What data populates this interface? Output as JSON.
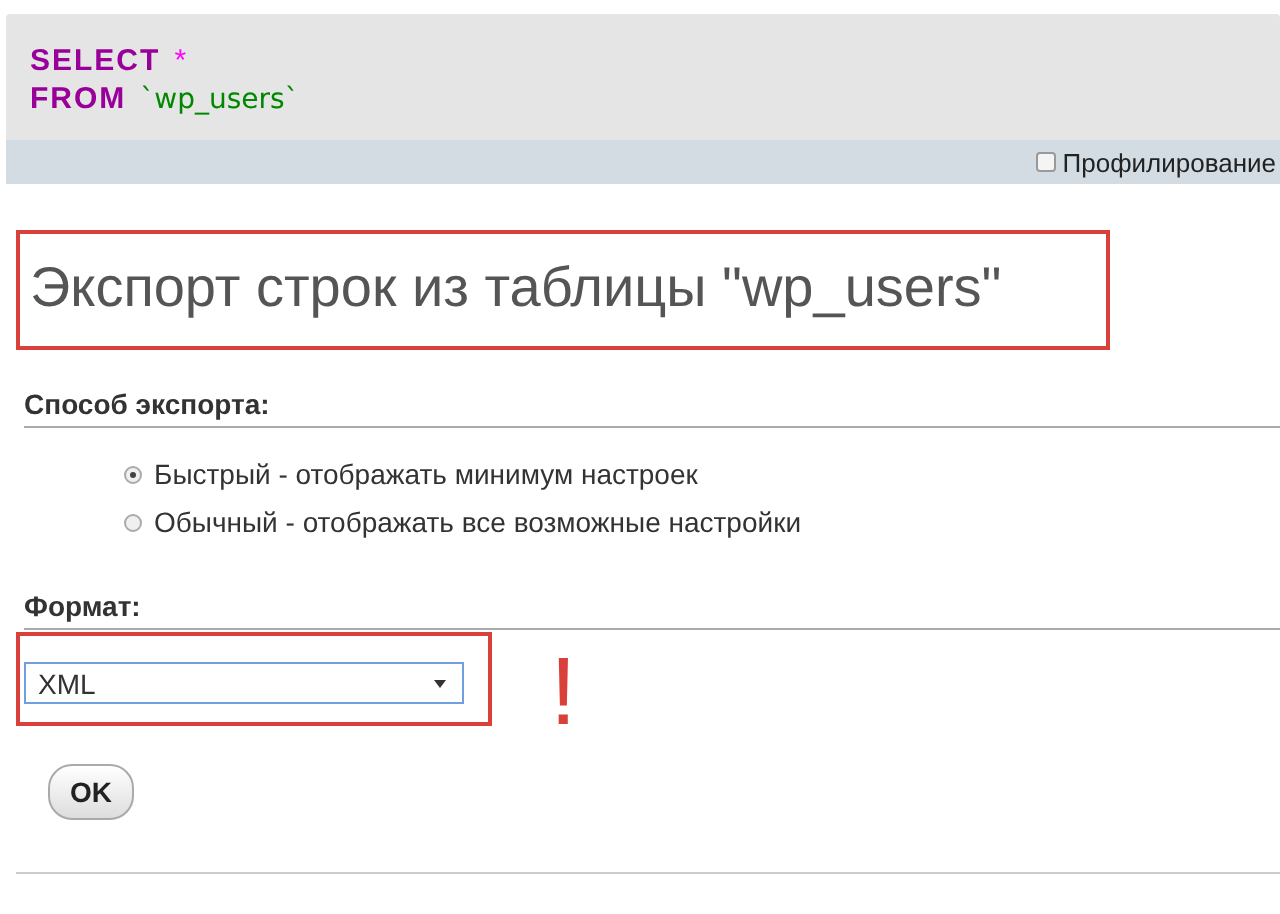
{
  "sql_query": {
    "lines": [
      [
        {
          "kind": "keyword",
          "text": "SELECT"
        },
        {
          "kind": "operator",
          "text": "*"
        }
      ],
      [
        {
          "kind": "keyword",
          "text": "FROM"
        },
        {
          "kind": "identifier",
          "text": "`wp_users`"
        }
      ]
    ]
  },
  "query_toolbar": {
    "profiling": {
      "label": "Профилирование",
      "checked": false
    }
  },
  "title": "Экспорт строк из таблицы \"wp_users\"",
  "export_method": {
    "heading": "Способ экспорта:",
    "options": [
      {
        "label": "Быстрый - отображать минимум настроек",
        "selected": true
      },
      {
        "label": "Обычный - отображать все возможные настройки",
        "selected": false
      }
    ]
  },
  "format": {
    "heading": "Формат:",
    "value": "XML",
    "annotation": "!"
  },
  "buttons": [
    "OK"
  ]
}
